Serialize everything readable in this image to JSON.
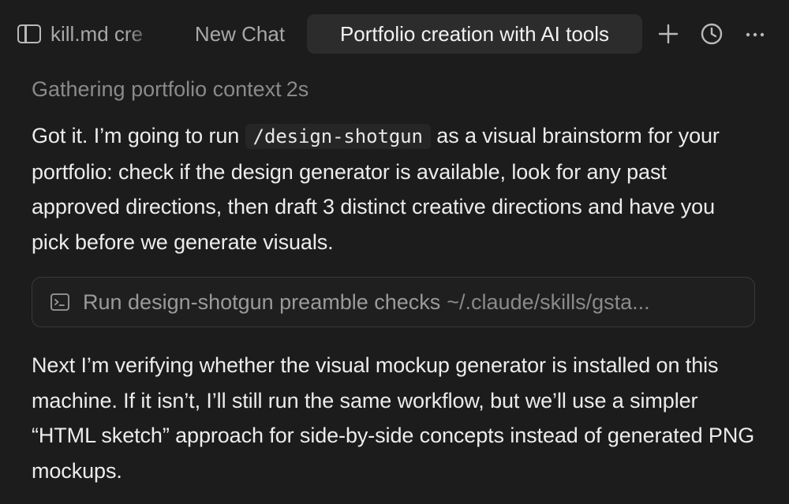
{
  "tabs": [
    {
      "label": "kill.md cre",
      "active": false
    },
    {
      "label": "New Chat",
      "active": false
    },
    {
      "label": "Portfolio creation with AI tools",
      "active": true
    }
  ],
  "toolbar": {
    "new_tab_icon": "plus-icon",
    "history_icon": "clock-icon",
    "more_icon": "ellipsis-icon"
  },
  "status": {
    "text": "Gathering portfolio context",
    "duration": "2s"
  },
  "message_1": {
    "before_code": "Got it. I’m going to run ",
    "code": "/design-shotgun",
    "after_code": " as a visual brainstorm for your portfolio: check if the design generator is available, look for any past approved directions, then draft 3 distinct creative directions and have you pick before we generate visuals."
  },
  "command": {
    "icon": "terminal-icon",
    "label": "Run design-shotgun preamble checks",
    "path": "~/.claude/skills/gsta..."
  },
  "message_2": {
    "text": "Next I’m verifying whether the visual mockup generator is installed on this machine. If it isn’t, I’ll still run the same workflow, but we’ll use a simpler “HTML sketch” approach for side-by-side concepts instead of generated PNG mockups."
  },
  "colors": {
    "background": "#1c1c1c",
    "active_tab": "#2c2c2c",
    "text_primary": "#ececec",
    "text_muted": "#8a8a8a"
  }
}
